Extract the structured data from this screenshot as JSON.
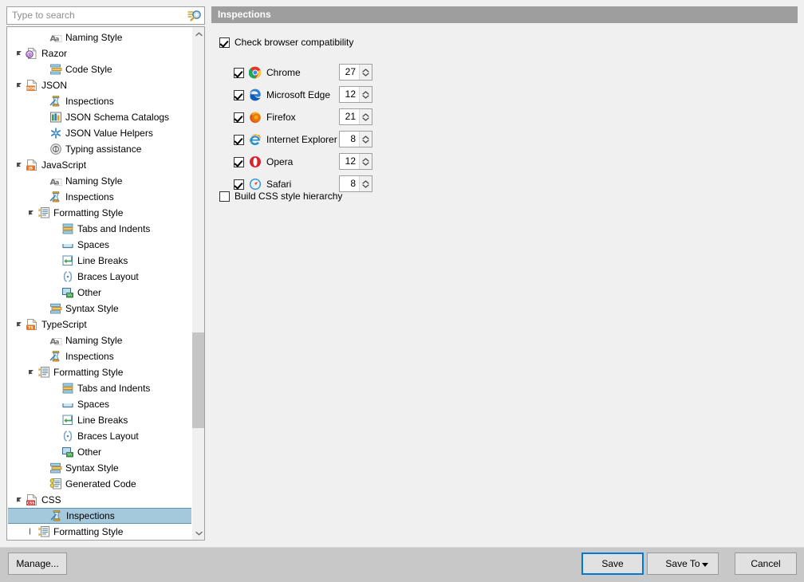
{
  "search": {
    "placeholder": "Type to search",
    "value": "",
    "icon": "search-icon"
  },
  "tree": {
    "items": [
      {
        "label": "Naming Style",
        "indent": 3,
        "twisty": "none",
        "icon": "naming-style-icon",
        "selected": false
      },
      {
        "label": "Razor",
        "indent": 1,
        "twisty": "expanded",
        "icon": "razor-file-icon",
        "selected": false
      },
      {
        "label": "Code Style",
        "indent": 3,
        "twisty": "none",
        "icon": "code-style-icon",
        "selected": false
      },
      {
        "label": "JSON",
        "indent": 1,
        "twisty": "expanded",
        "icon": "json-file-icon",
        "selected": false
      },
      {
        "label": "Inspections",
        "indent": 3,
        "twisty": "none",
        "icon": "inspections-icon",
        "selected": false
      },
      {
        "label": "JSON Schema Catalogs",
        "indent": 3,
        "twisty": "none",
        "icon": "schema-catalogs-icon",
        "selected": false
      },
      {
        "label": "JSON Value Helpers",
        "indent": 3,
        "twisty": "none",
        "icon": "value-helpers-icon",
        "selected": false
      },
      {
        "label": "Typing assistance",
        "indent": 3,
        "twisty": "none",
        "icon": "typing-assistance-icon",
        "selected": false
      },
      {
        "label": "JavaScript",
        "indent": 1,
        "twisty": "expanded",
        "icon": "javascript-file-icon",
        "selected": false
      },
      {
        "label": "Naming Style",
        "indent": 3,
        "twisty": "none",
        "icon": "naming-style-icon",
        "selected": false
      },
      {
        "label": "Inspections",
        "indent": 3,
        "twisty": "none",
        "icon": "inspections-icon",
        "selected": false
      },
      {
        "label": "Formatting Style",
        "indent": 2,
        "twisty": "expanded",
        "icon": "formatting-style-icon",
        "selected": false
      },
      {
        "label": "Tabs and Indents",
        "indent": 4,
        "twisty": "none",
        "icon": "tabs-indents-icon",
        "selected": false
      },
      {
        "label": "Spaces",
        "indent": 4,
        "twisty": "none",
        "icon": "spaces-icon",
        "selected": false
      },
      {
        "label": "Line Breaks",
        "indent": 4,
        "twisty": "none",
        "icon": "line-breaks-icon",
        "selected": false
      },
      {
        "label": "Braces Layout",
        "indent": 4,
        "twisty": "none",
        "icon": "braces-layout-icon",
        "selected": false
      },
      {
        "label": "Other",
        "indent": 4,
        "twisty": "none",
        "icon": "other-icon",
        "selected": false
      },
      {
        "label": "Syntax Style",
        "indent": 3,
        "twisty": "none",
        "icon": "syntax-style-icon",
        "selected": false
      },
      {
        "label": "TypeScript",
        "indent": 1,
        "twisty": "expanded",
        "icon": "typescript-file-icon",
        "selected": false
      },
      {
        "label": "Naming Style",
        "indent": 3,
        "twisty": "none",
        "icon": "naming-style-icon",
        "selected": false
      },
      {
        "label": "Inspections",
        "indent": 3,
        "twisty": "none",
        "icon": "inspections-icon",
        "selected": false
      },
      {
        "label": "Formatting Style",
        "indent": 2,
        "twisty": "expanded",
        "icon": "formatting-style-icon",
        "selected": false
      },
      {
        "label": "Tabs and Indents",
        "indent": 4,
        "twisty": "none",
        "icon": "tabs-indents-icon",
        "selected": false
      },
      {
        "label": "Spaces",
        "indent": 4,
        "twisty": "none",
        "icon": "spaces-icon",
        "selected": false
      },
      {
        "label": "Line Breaks",
        "indent": 4,
        "twisty": "none",
        "icon": "line-breaks-icon",
        "selected": false
      },
      {
        "label": "Braces Layout",
        "indent": 4,
        "twisty": "none",
        "icon": "braces-layout-icon",
        "selected": false
      },
      {
        "label": "Other",
        "indent": 4,
        "twisty": "none",
        "icon": "other-icon",
        "selected": false
      },
      {
        "label": "Syntax Style",
        "indent": 3,
        "twisty": "none",
        "icon": "syntax-style-icon",
        "selected": false
      },
      {
        "label": "Generated Code",
        "indent": 3,
        "twisty": "none",
        "icon": "generated-code-icon",
        "selected": false
      },
      {
        "label": "CSS",
        "indent": 1,
        "twisty": "expanded",
        "icon": "css-file-icon",
        "selected": false
      },
      {
        "label": "Inspections",
        "indent": 3,
        "twisty": "none",
        "icon": "inspections-icon",
        "selected": true
      },
      {
        "label": "Formatting Style",
        "indent": 2,
        "twisty": "collapsed",
        "icon": "formatting-style-icon",
        "selected": false
      }
    ],
    "scrollbar": {
      "up_icon": "chevron-up-icon",
      "down_icon": "chevron-down-icon"
    }
  },
  "panel": {
    "header_title": "Inspections",
    "browser_compat": {
      "label": "Check browser compatibility",
      "checked": true
    },
    "browsers": [
      {
        "name": "Chrome",
        "checked": true,
        "version": "27",
        "icon": "chrome-icon"
      },
      {
        "name": "Microsoft Edge",
        "checked": true,
        "version": "12",
        "icon": "edge-icon"
      },
      {
        "name": "Firefox",
        "checked": true,
        "version": "21",
        "icon": "firefox-icon"
      },
      {
        "name": "Internet Explorer",
        "checked": true,
        "version": "8",
        "icon": "ie-icon"
      },
      {
        "name": "Opera",
        "checked": true,
        "version": "12",
        "icon": "opera-icon"
      },
      {
        "name": "Safari",
        "checked": true,
        "version": "8",
        "icon": "safari-icon"
      }
    ],
    "build_css_hierarchy": {
      "label": "Build CSS style hierarchy",
      "checked": false
    }
  },
  "footer": {
    "manage_label": "Manage...",
    "save_label": "Save",
    "save_to_label": "Save To",
    "cancel_label": "Cancel"
  },
  "colors": {
    "header_bar": "#9e9e9e",
    "selection": "#a4c8dc",
    "focus_border": "#0078d7",
    "dialog_bg": "#f0f0f0",
    "footer_bg": "#c8c8c8"
  }
}
